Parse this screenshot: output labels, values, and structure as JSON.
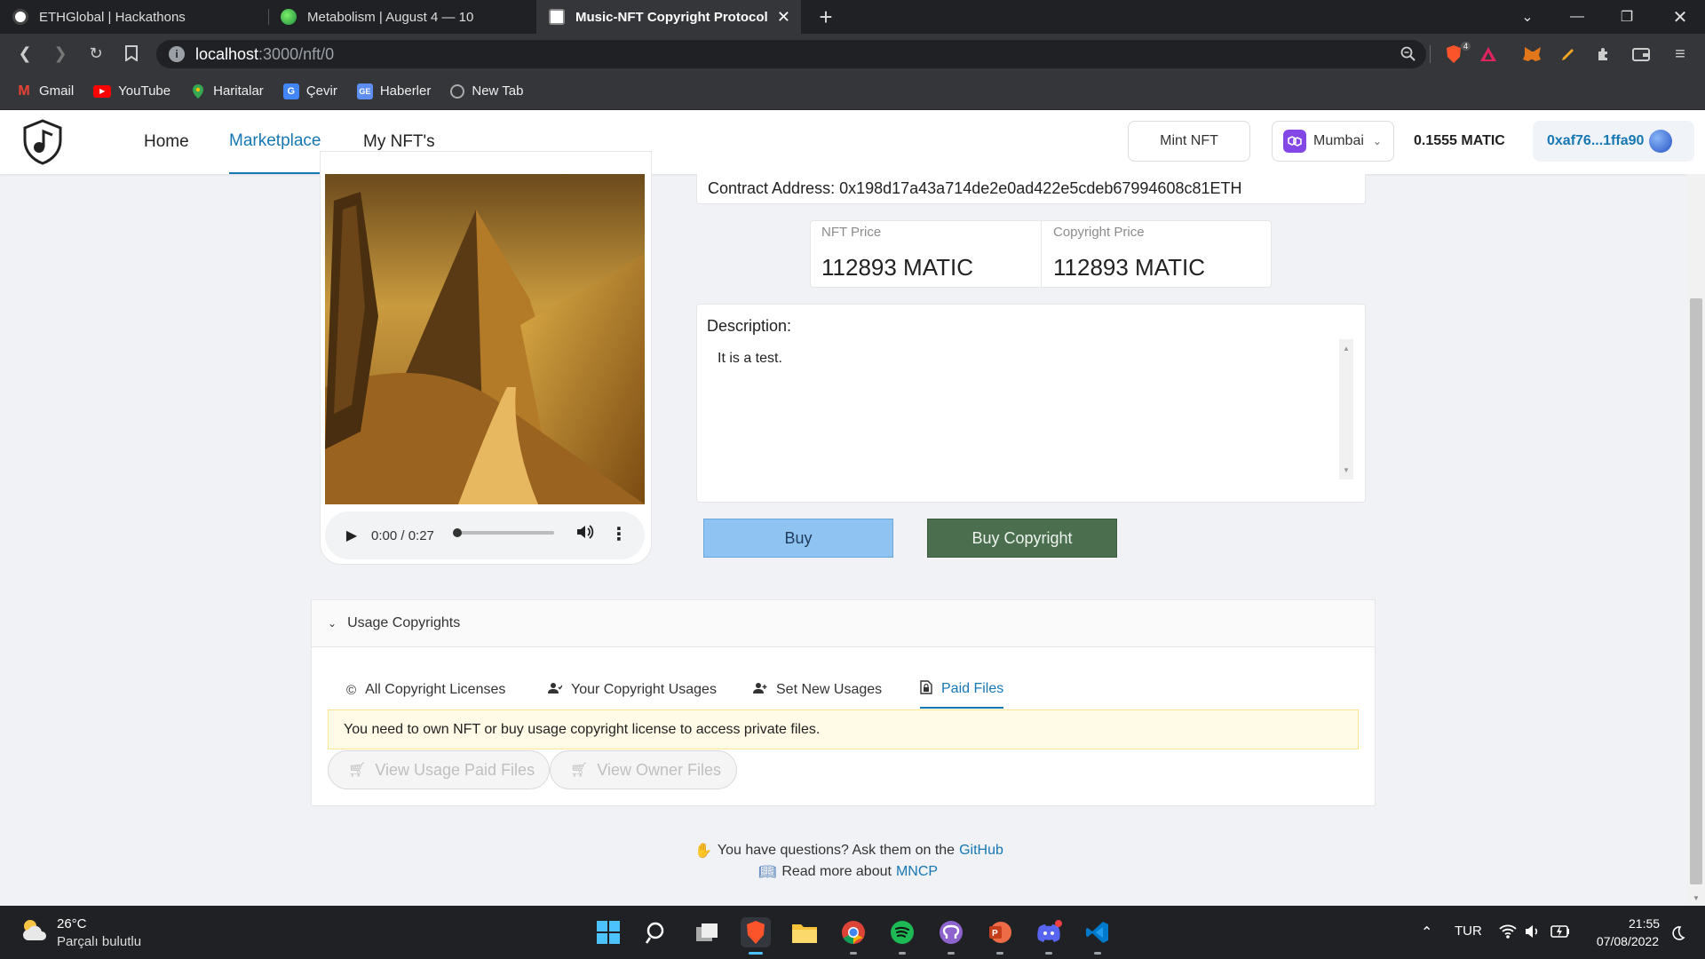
{
  "browser": {
    "tabs": [
      {
        "title": "ETHGlobal | Hackathons"
      },
      {
        "title": "Metabolism | August 4 — 10"
      },
      {
        "title": "Music-NFT Copyright Protocol"
      }
    ],
    "new_tab": "+",
    "url_host": "localhost",
    "url_path": ":3000/nft/0",
    "shield_count": "4",
    "bookmarks": [
      {
        "label": "Gmail"
      },
      {
        "label": "YouTube"
      },
      {
        "label": "Haritalar"
      },
      {
        "label": "Çevir"
      },
      {
        "label": "Haberler"
      },
      {
        "label": "New Tab"
      }
    ]
  },
  "header": {
    "menu": [
      {
        "label": "Home"
      },
      {
        "label": "Marketplace"
      },
      {
        "label": "My NFT's"
      }
    ],
    "mint_label": "Mint NFT",
    "network": "Mumbai",
    "balance": "0.1555 MATIC",
    "account": "0xaf76...1ffa90"
  },
  "nft": {
    "contract": "Contract Address: 0x198d17a43a714de2e0ad422e5cdeb67994608c81ETH",
    "nft_price_label": "NFT Price",
    "nft_price": "112893 MATIC",
    "copyright_price_label": "Copyright Price",
    "copyright_price": "112893 MATIC",
    "description_label": "Description:",
    "description": "It is a test.",
    "buy_label": "Buy",
    "buy_copyright_label": "Buy Copyright",
    "audio_time": "0:00 / 0:27",
    "audio_progress": 0.0
  },
  "usage": {
    "title": "Usage Copyrights",
    "tabs": [
      {
        "label": "All Copyright Licenses"
      },
      {
        "label": "Your Copyright Usages"
      },
      {
        "label": "Set New Usages"
      },
      {
        "label": "Paid Files"
      }
    ],
    "active_tab": "Paid Files",
    "warning": "You need to own NFT or buy usage copyright license to access private files.",
    "view_usage": "View Usage Paid Files",
    "view_owner": "View Owner Files"
  },
  "footer": {
    "q_text": "You have questions? Ask them on the",
    "q_link": "GitHub",
    "r_text": "Read more about",
    "r_link": "MNCP"
  },
  "taskbar": {
    "temp": "26°C",
    "weather": "Parçalı bulutlu",
    "lang": "TUR",
    "time": "21:55",
    "date": "07/08/2022"
  },
  "colors": {
    "accent": "#1677b3",
    "buy_bg": "#8fc4f2",
    "buy_copyright_bg": "#4a6e4e",
    "warning_bg": "#fffbe6"
  }
}
